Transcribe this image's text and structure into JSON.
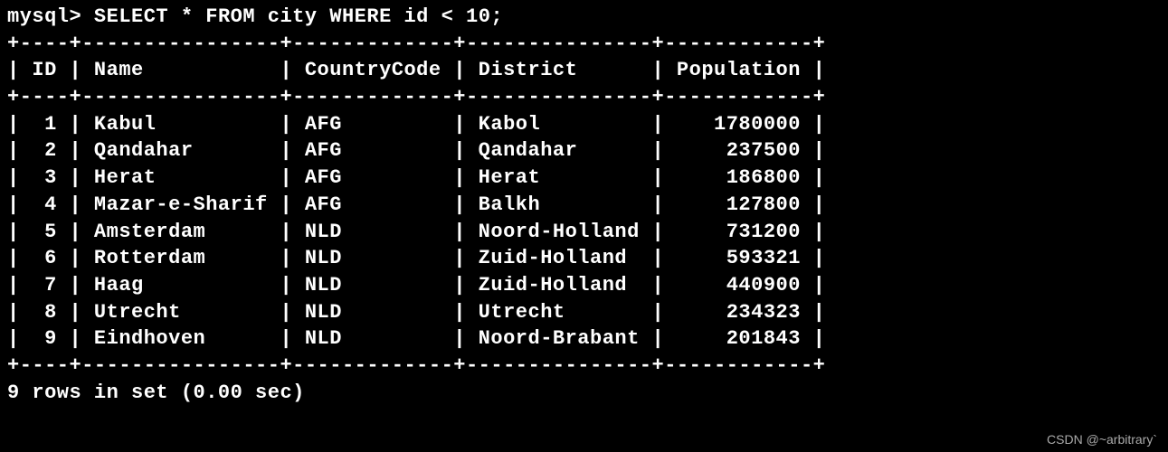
{
  "prompt": "mysql> ",
  "query": "SELECT * FROM city WHERE id < 10;",
  "border_top": "+----+----------------+-------------+---------------+------------+",
  "header_line": "| ID | Name           | CountryCode | District      | Population |",
  "columns": [
    "ID",
    "Name",
    "CountryCode",
    "District",
    "Population"
  ],
  "rows": [
    {
      "id": 1,
      "name": "Kabul",
      "country": "AFG",
      "district": "Kabol",
      "population": 1780000
    },
    {
      "id": 2,
      "name": "Qandahar",
      "country": "AFG",
      "district": "Qandahar",
      "population": 237500
    },
    {
      "id": 3,
      "name": "Herat",
      "country": "AFG",
      "district": "Herat",
      "population": 186800
    },
    {
      "id": 4,
      "name": "Mazar-e-Sharif",
      "country": "AFG",
      "district": "Balkh",
      "population": 127800
    },
    {
      "id": 5,
      "name": "Amsterdam",
      "country": "NLD",
      "district": "Noord-Holland",
      "population": 731200
    },
    {
      "id": 6,
      "name": "Rotterdam",
      "country": "NLD",
      "district": "Zuid-Holland",
      "population": 593321
    },
    {
      "id": 7,
      "name": "Haag",
      "country": "NLD",
      "district": "Zuid-Holland",
      "population": 440900
    },
    {
      "id": 8,
      "name": "Utrecht",
      "country": "NLD",
      "district": "Utrecht",
      "population": 234323
    },
    {
      "id": 9,
      "name": "Eindhoven",
      "country": "NLD",
      "district": "Noord-Brabant",
      "population": 201843
    }
  ],
  "row_lines": [
    "|  1 | Kabul          | AFG         | Kabol         |    1780000 |",
    "|  2 | Qandahar       | AFG         | Qandahar      |     237500 |",
    "|  3 | Herat          | AFG         | Herat         |     186800 |",
    "|  4 | Mazar-e-Sharif | AFG         | Balkh         |     127800 |",
    "|  5 | Amsterdam      | NLD         | Noord-Holland |     731200 |",
    "|  6 | Rotterdam      | NLD         | Zuid-Holland  |     593321 |",
    "|  7 | Haag           | NLD         | Zuid-Holland  |     440900 |",
    "|  8 | Utrecht        | NLD         | Utrecht       |     234323 |",
    "|  9 | Eindhoven      | NLD         | Noord-Brabant |     201843 |"
  ],
  "footer": "9 rows in set (0.00 sec)",
  "watermark": "CSDN @~arbitrary`"
}
